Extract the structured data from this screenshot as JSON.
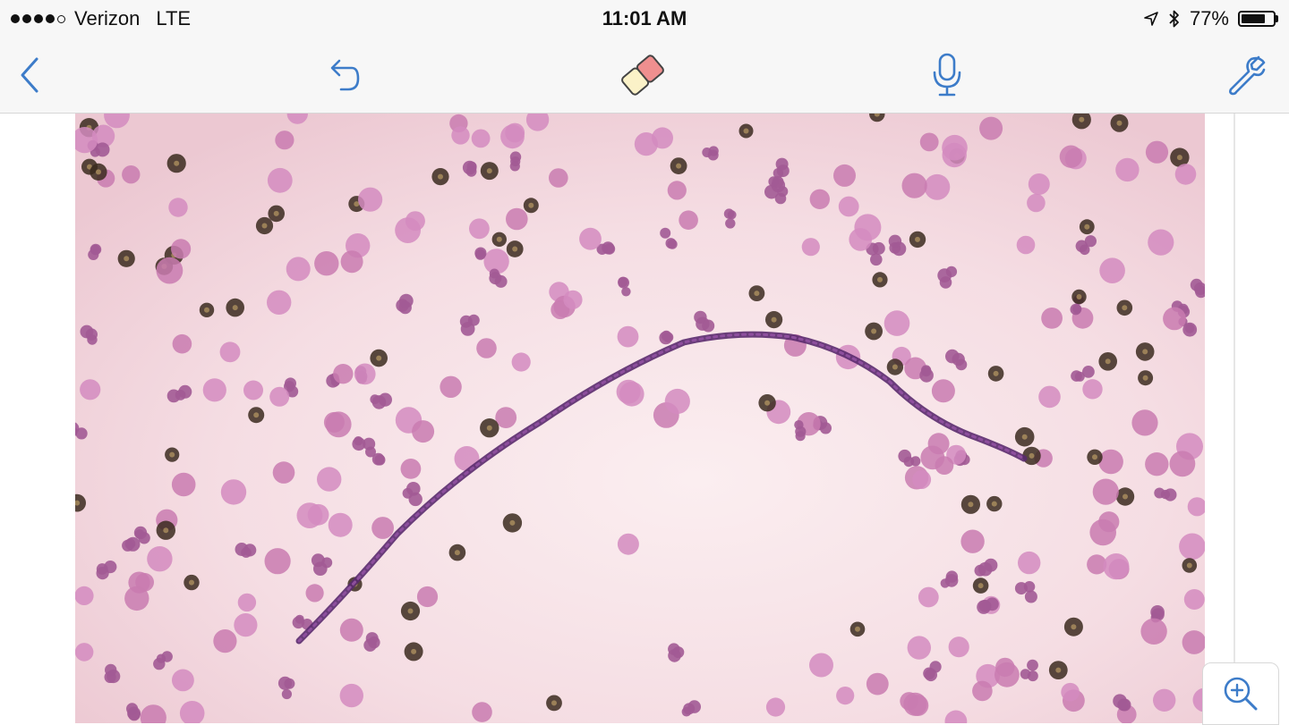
{
  "status_bar": {
    "carrier": "Verizon",
    "network": "LTE",
    "time": "11:01 AM",
    "battery_text": "77%",
    "battery_level": 0.77
  },
  "toolbar": {
    "accent_color": "#3d7cc9",
    "buttons": [
      {
        "name": "back",
        "icon": "chevron-left-icon"
      },
      {
        "name": "undo",
        "icon": "undo-arrow-icon"
      },
      {
        "name": "eraser",
        "icon": "eraser-icon"
      },
      {
        "name": "dictation",
        "icon": "microphone-icon"
      },
      {
        "name": "tools",
        "icon": "wrench-icon"
      }
    ]
  },
  "image": {
    "subject": "stained blood smear micrograph",
    "background_color": "#f2d6dd",
    "cell_color": "#c97bb0",
    "nucleus_color": "#3b2a1e",
    "worm_color": "#5a2a6e"
  },
  "zoom_button": {
    "icon": "zoom-in-icon"
  }
}
